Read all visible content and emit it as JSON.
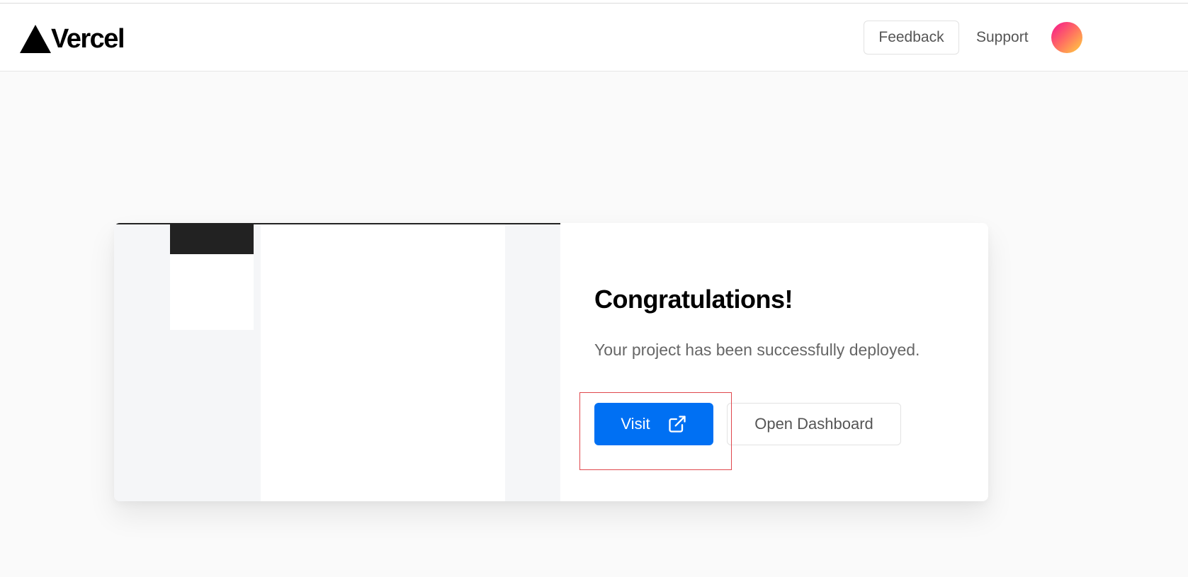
{
  "header": {
    "logo_text": "Vercel",
    "feedback_label": "Feedback",
    "support_label": "Support",
    "avatar_gradient": [
      "#f72585",
      "#ff6f61",
      "#ffd23f"
    ]
  },
  "card": {
    "title": "Congratulations!",
    "message": "Your project has been successfully deployed.",
    "visit_label": "Visit",
    "visit_icon": "external-link-icon",
    "dashboard_label": "Open Dashboard"
  },
  "colors": {
    "primary": "#0070f3",
    "background": "#fafafa",
    "highlight": "#e0474c"
  }
}
